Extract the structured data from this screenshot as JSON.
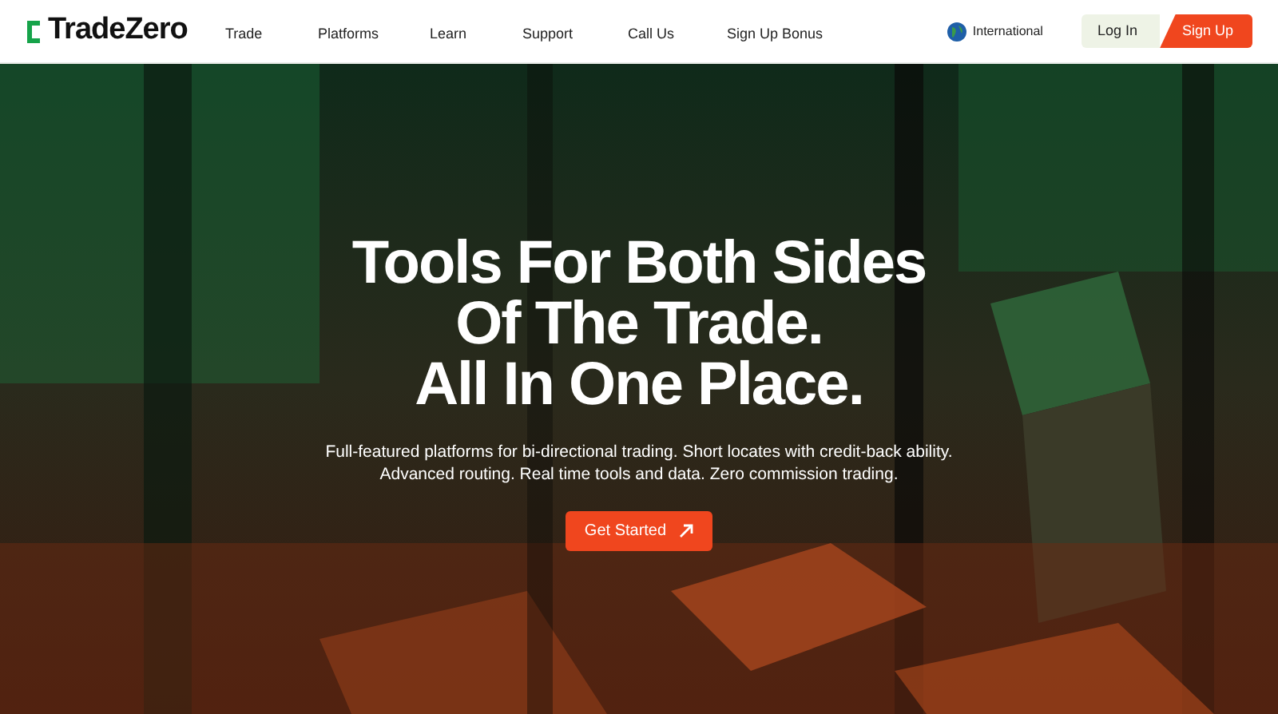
{
  "brand": {
    "name": "TradeZero"
  },
  "nav": [
    {
      "label": "Trade"
    },
    {
      "label": "Platforms"
    },
    {
      "label": "Learn"
    },
    {
      "label": "Support"
    },
    {
      "label": "Call Us"
    },
    {
      "label": "Sign Up Bonus"
    }
  ],
  "region": {
    "label": "International"
  },
  "auth": {
    "login": "Log In",
    "signup": "Sign Up"
  },
  "hero": {
    "headline": [
      "Tools For Both Sides",
      "Of The Trade.",
      "All In One Place."
    ],
    "text": "Full-featured platforms for bi-directional trading. Short locates with credit-back ability. Advanced routing. Real time tools and data. Zero commission trading.",
    "cta": "Get Started"
  }
}
